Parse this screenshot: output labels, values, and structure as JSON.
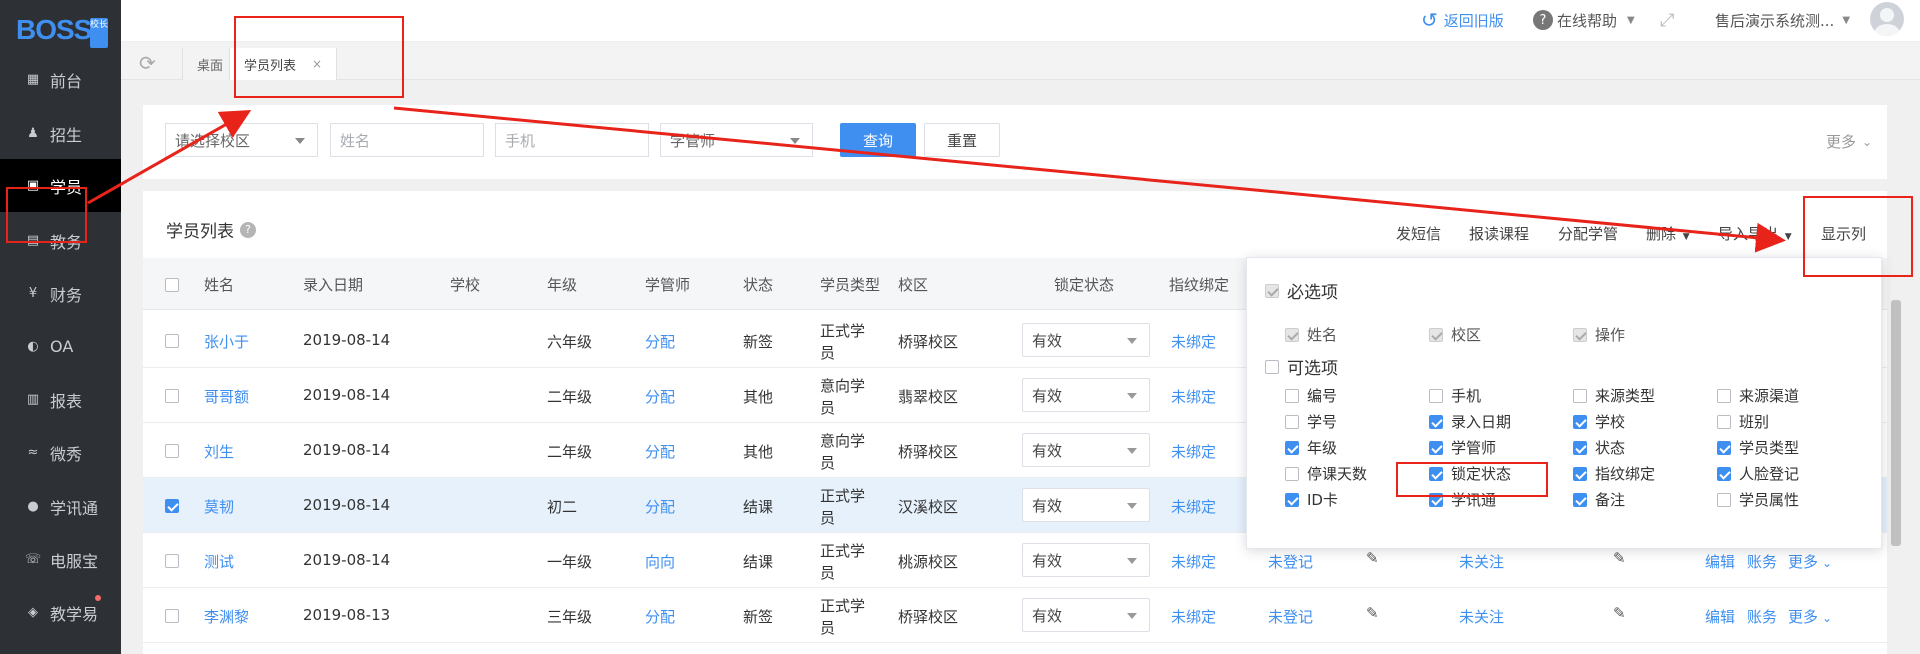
{
  "sidebar": {
    "logo": "BOSS",
    "logo_tag": "校长",
    "items": [
      {
        "label": "前台",
        "icon": "calendar-icon"
      },
      {
        "label": "招生",
        "icon": "user-plus-icon"
      },
      {
        "label": "学员",
        "icon": "student-card-icon"
      },
      {
        "label": "教务",
        "icon": "book-icon"
      },
      {
        "label": "财务",
        "icon": "yen-icon"
      },
      {
        "label": "OA",
        "icon": "chat-icon"
      },
      {
        "label": "报表",
        "icon": "bar-chart-icon"
      },
      {
        "label": "微秀",
        "icon": "leaf-icon"
      },
      {
        "label": "学讯通",
        "icon": "location-icon"
      },
      {
        "label": "电服宝",
        "icon": "phone-icon"
      },
      {
        "label": "教学易",
        "icon": "graduation-icon"
      }
    ]
  },
  "header": {
    "back_label": "返回旧版",
    "help_label": "在线帮助",
    "user_label": "售后演示系统测..."
  },
  "tabs": [
    {
      "label": "桌面"
    },
    {
      "label": "学员列表",
      "close": "×"
    }
  ],
  "filters": {
    "campus_placeholder": "请选择校区",
    "name_placeholder": "姓名",
    "phone_placeholder": "手机",
    "manager_placeholder": "学管师",
    "search_label": "查询",
    "reset_label": "重置",
    "more_label": "更多"
  },
  "list": {
    "title": "学员列表",
    "actions": [
      "发短信",
      "报读课程",
      "分配学管",
      "删除",
      "导入导出",
      "显示列"
    ],
    "columns": [
      "姓名",
      "录入日期",
      "学校",
      "年级",
      "学管师",
      "状态",
      "学员类型",
      "校区",
      "锁定状态",
      "指纹绑定"
    ],
    "rows": [
      {
        "name": "张小于",
        "date": "2019-08-14",
        "school": "",
        "grade": "六年级",
        "manager": "分配",
        "status": "新签",
        "type_l1": "正式学",
        "type_l2": "员",
        "campus": "桥驿校区",
        "lock": "有效",
        "fingerprint": "未绑定",
        "selected": false
      },
      {
        "name": "哥哥额",
        "date": "2019-08-14",
        "school": "",
        "grade": "二年级",
        "manager": "分配",
        "status": "其他",
        "type_l1": "意向学",
        "type_l2": "员",
        "campus": "翡翠校区",
        "lock": "有效",
        "fingerprint": "未绑定",
        "selected": false
      },
      {
        "name": "刘生",
        "date": "2019-08-14",
        "school": "",
        "grade": "二年级",
        "manager": "分配",
        "status": "其他",
        "type_l1": "意向学",
        "type_l2": "员",
        "campus": "桥驿校区",
        "lock": "有效",
        "fingerprint": "未绑定",
        "selected": false
      },
      {
        "name": "莫韧",
        "date": "2019-08-14",
        "school": "",
        "grade": "初二",
        "manager": "分配",
        "status": "结课",
        "type_l1": "正式学",
        "type_l2": "员",
        "campus": "汉溪校区",
        "lock": "有效",
        "fingerprint": "未绑定",
        "selected": true
      },
      {
        "name": "测试",
        "date": "2019-08-14",
        "school": "",
        "grade": "一年级",
        "manager": "向向",
        "status": "结课",
        "type_l1": "正式学",
        "type_l2": "员",
        "campus": "桃源校区",
        "lock": "有效",
        "fingerprint": "未绑定",
        "face": "未登记",
        "wechat": "未关注",
        "ops": [
          "编辑",
          "账务",
          "更多"
        ],
        "selected": false
      },
      {
        "name": "李渊黎",
        "date": "2019-08-13",
        "school": "",
        "grade": "三年级",
        "manager": "分配",
        "status": "新签",
        "type_l1": "正式学",
        "type_l2": "员",
        "campus": "桥驿校区",
        "lock": "有效",
        "fingerprint": "未绑定",
        "face": "未登记",
        "wechat": "未关注",
        "ops": [
          "编辑",
          "账务",
          "更多"
        ],
        "selected": false
      }
    ]
  },
  "column_popup": {
    "required_title": "必选项",
    "required": [
      "姓名",
      "校区",
      "操作"
    ],
    "optional_title": "可选项",
    "optional": [
      {
        "label": "编号",
        "checked": false
      },
      {
        "label": "手机",
        "checked": false
      },
      {
        "label": "来源类型",
        "checked": false
      },
      {
        "label": "来源渠道",
        "checked": false
      },
      {
        "label": "学号",
        "checked": false
      },
      {
        "label": "录入日期",
        "checked": true
      },
      {
        "label": "学校",
        "checked": true
      },
      {
        "label": "班别",
        "checked": false
      },
      {
        "label": "年级",
        "checked": true
      },
      {
        "label": "学管师",
        "checked": true
      },
      {
        "label": "状态",
        "checked": true
      },
      {
        "label": "学员类型",
        "checked": true
      },
      {
        "label": "停课天数",
        "checked": false
      },
      {
        "label": "锁定状态",
        "checked": true
      },
      {
        "label": "指纹绑定",
        "checked": true
      },
      {
        "label": "人脸登记",
        "checked": true
      },
      {
        "label": "ID卡",
        "checked": true
      },
      {
        "label": "学讯通",
        "checked": true
      },
      {
        "label": "备注",
        "checked": true
      },
      {
        "label": "学员属性",
        "checked": false
      }
    ]
  },
  "colors": {
    "accent": "#3f8ff0",
    "sidebar": "#2d3035",
    "annotation": "#e8231a"
  }
}
